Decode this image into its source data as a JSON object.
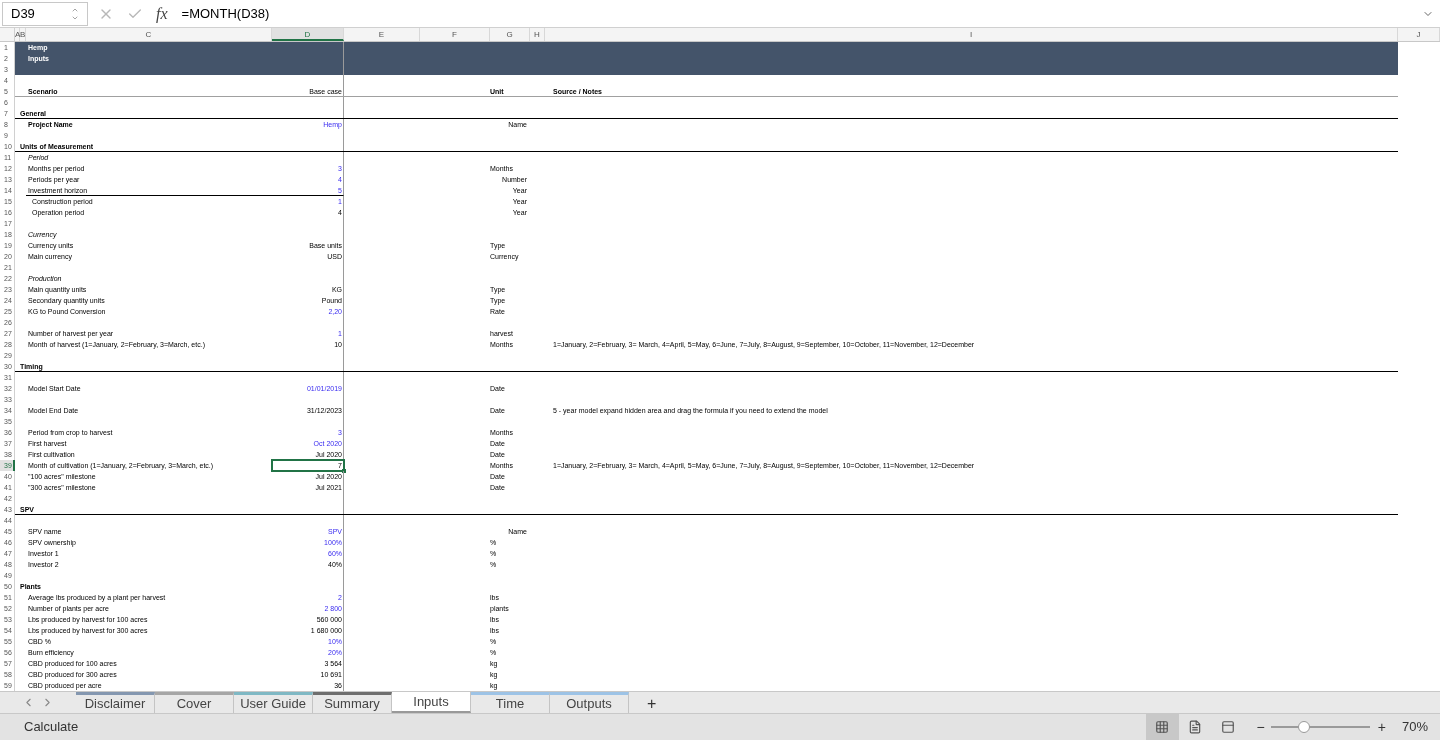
{
  "formula_bar": {
    "name_box": "D39",
    "function_label": "fx",
    "formula": "=MONTH(D38)"
  },
  "columns": [
    {
      "label": "A",
      "selected": false
    },
    {
      "label": "B",
      "selected": false
    },
    {
      "label": "C",
      "selected": false
    },
    {
      "label": "D",
      "selected": true
    },
    {
      "label": "E",
      "selected": false
    },
    {
      "label": "F",
      "selected": false
    },
    {
      "label": "G",
      "selected": false
    },
    {
      "label": "H",
      "selected": false
    },
    {
      "label": "I",
      "selected": false
    },
    {
      "label": "J",
      "selected": false
    }
  ],
  "rows": [
    {
      "n": "1",
      "kind": "banner",
      "label": "Hemp",
      "selected": false
    },
    {
      "n": "2",
      "kind": "banner",
      "label": "Inputs",
      "selected": false
    },
    {
      "n": "3",
      "kind": "banner",
      "selected": false
    },
    {
      "n": "4",
      "kind": "blank",
      "selected": false
    },
    {
      "n": "5",
      "kind": "head",
      "label": "Scenario",
      "value": "Base case",
      "input": false,
      "unit": "Unit",
      "note": "Source / Notes",
      "selected": false
    },
    {
      "n": "6",
      "kind": "blank",
      "selected": false
    },
    {
      "n": "7",
      "kind": "section",
      "label": "General",
      "selected": false
    },
    {
      "n": "8",
      "kind": "field",
      "label": "Project Name",
      "value": "Hemp",
      "input": true,
      "unit": "Name",
      "unit_right": true,
      "selected": false
    },
    {
      "n": "9",
      "kind": "blank",
      "selected": false
    },
    {
      "n": "10",
      "kind": "section",
      "label": "Units of Measurement",
      "selected": false
    },
    {
      "n": "11",
      "kind": "group",
      "label": "Period",
      "selected": false
    },
    {
      "n": "12",
      "kind": "item",
      "label": "Months per period",
      "value": "3",
      "input": true,
      "unit": "Months",
      "selected": false
    },
    {
      "n": "13",
      "kind": "item",
      "label": "Periods per year",
      "value": "4",
      "input": true,
      "unit": "Number",
      "unit_right": true,
      "selected": false
    },
    {
      "n": "14",
      "kind": "ruled",
      "label": "Investment horizon",
      "value": "5",
      "input": true,
      "unit": "Year",
      "unit_right": true,
      "selected": false
    },
    {
      "n": "15",
      "kind": "subitem",
      "label": "Construction period",
      "value": "1",
      "input": true,
      "unit": "Year",
      "unit_right": true,
      "selected": false
    },
    {
      "n": "16",
      "kind": "subitem",
      "label": "Operation period",
      "value": "4",
      "input": false,
      "unit": "Year",
      "unit_right": true,
      "selected": false
    },
    {
      "n": "17",
      "kind": "blank",
      "selected": false
    },
    {
      "n": "18",
      "kind": "group",
      "label": "Currency",
      "selected": false
    },
    {
      "n": "19",
      "kind": "item",
      "label": "Currency units",
      "value": "Base units",
      "input": false,
      "unit": "Type",
      "selected": false
    },
    {
      "n": "20",
      "kind": "item",
      "label": "Main currency",
      "value": "USD",
      "input": false,
      "unit": "Currency",
      "selected": false
    },
    {
      "n": "21",
      "kind": "blank",
      "selected": false
    },
    {
      "n": "22",
      "kind": "group",
      "label": "Production",
      "selected": false
    },
    {
      "n": "23",
      "kind": "item",
      "label": "Main quantity units",
      "value": "KG",
      "input": false,
      "unit": "Type",
      "selected": false
    },
    {
      "n": "24",
      "kind": "item",
      "label": "Secondary quantity units",
      "value": "Pound",
      "input": false,
      "unit": "Type",
      "selected": false
    },
    {
      "n": "25",
      "kind": "item",
      "label": "KG to Pound Conversion",
      "value": "2,20",
      "input": true,
      "unit": "Rate",
      "selected": false
    },
    {
      "n": "26",
      "kind": "blank",
      "selected": false
    },
    {
      "n": "27",
      "kind": "item",
      "label": "Number of harvest per year",
      "value": "1",
      "input": true,
      "unit": "harvest",
      "selected": false
    },
    {
      "n": "28",
      "kind": "item",
      "label": "Month of harvest (1=January, 2=February, 3=March, etc.)",
      "value": "10",
      "input": false,
      "unit": "Months",
      "note": "1=January, 2=February, 3= March, 4=April, 5=May, 6=June, 7=July, 8=August, 9=September, 10=October, 11=November, 12=December",
      "selected": false
    },
    {
      "n": "29",
      "kind": "blank",
      "selected": false
    },
    {
      "n": "30",
      "kind": "section",
      "label": "Timing",
      "selected": false
    },
    {
      "n": "31",
      "kind": "blank",
      "selected": false
    },
    {
      "n": "32",
      "kind": "item",
      "label": "Model Start Date",
      "value": "01/01/2019",
      "input": true,
      "unit": "Date",
      "selected": false
    },
    {
      "n": "33",
      "kind": "blank",
      "selected": false
    },
    {
      "n": "34",
      "kind": "item",
      "label": "Model End Date",
      "value": "31/12/2023",
      "input": false,
      "unit": "Date",
      "note": "5 - year model expand hidden area and drag the formula if you need to extend the model",
      "selected": false
    },
    {
      "n": "35",
      "kind": "blank",
      "selected": false
    },
    {
      "n": "36",
      "kind": "item",
      "label": "Period from crop to harvest",
      "value": "3",
      "input": true,
      "unit": "Months",
      "selected": false
    },
    {
      "n": "37",
      "kind": "item",
      "label": "First harvest",
      "value": "Oct 2020",
      "input": true,
      "unit": "Date",
      "selected": false
    },
    {
      "n": "38",
      "kind": "item",
      "label": "First cultivation",
      "value": "Jul 2020",
      "input": false,
      "unit": "Date",
      "selected": false
    },
    {
      "n": "39",
      "kind": "item",
      "label": "Month of cultivation (1=January, 2=February, 3=March, etc.)",
      "value": "7",
      "input": false,
      "unit": "Months",
      "note": "1=January, 2=February, 3= March, 4=April, 5=May, 6=June, 7=July, 8=August, 9=September, 10=October, 11=November, 12=December",
      "selected": true
    },
    {
      "n": "40",
      "kind": "item",
      "label": "\"100 acres\" milestone",
      "value": "Jul 2020",
      "input": false,
      "unit": "Date",
      "selected": false
    },
    {
      "n": "41",
      "kind": "item",
      "label": "\"300 acres\" milestone",
      "value": "Jul 2021",
      "input": false,
      "unit": "Date",
      "selected": false
    },
    {
      "n": "42",
      "kind": "blank",
      "selected": false
    },
    {
      "n": "43",
      "kind": "section",
      "label": "SPV",
      "selected": false
    },
    {
      "n": "44",
      "kind": "blank",
      "selected": false
    },
    {
      "n": "45",
      "kind": "item",
      "label": "SPV name",
      "value": "SPV",
      "input": true,
      "unit": "Name",
      "unit_right": true,
      "selected": false
    },
    {
      "n": "46",
      "kind": "item",
      "label": "SPV ownership",
      "value": "100%",
      "input": true,
      "unit": "%",
      "selected": false
    },
    {
      "n": "47",
      "kind": "item",
      "label": "Investor 1",
      "value": "60%",
      "input": true,
      "unit": "%",
      "selected": false
    },
    {
      "n": "48",
      "kind": "item",
      "label": "Investor 2",
      "value": "40%",
      "input": false,
      "unit": "%",
      "selected": false
    },
    {
      "n": "49",
      "kind": "blank",
      "selected": false
    },
    {
      "n": "50",
      "kind": "subhead",
      "label": "Plants",
      "selected": false
    },
    {
      "n": "51",
      "kind": "item",
      "label": "Average lbs produced by a plant per harvest",
      "value": "2",
      "input": true,
      "unit": "lbs",
      "selected": false
    },
    {
      "n": "52",
      "kind": "item",
      "label": "Number of plants per acre",
      "value": "2 800",
      "input": true,
      "unit": "plants",
      "selected": false
    },
    {
      "n": "53",
      "kind": "item",
      "label": "Lbs produced by harvest for 100 acres",
      "value": "560 000",
      "input": false,
      "unit": "lbs",
      "selected": false
    },
    {
      "n": "54",
      "kind": "item",
      "label": "Lbs produced by harvest for 300 acres",
      "value": "1 680 000",
      "input": false,
      "unit": "lbs",
      "selected": false
    },
    {
      "n": "55",
      "kind": "item",
      "label": "CBD %",
      "value": "10%",
      "input": true,
      "unit": "%",
      "selected": false
    },
    {
      "n": "56",
      "kind": "item",
      "label": "Burn efficiency",
      "value": "20%",
      "input": true,
      "unit": "%",
      "selected": false
    },
    {
      "n": "57",
      "kind": "item",
      "label": "CBD produced for 100 acres",
      "value": "3 564",
      "input": false,
      "unit": "kg",
      "selected": false
    },
    {
      "n": "58",
      "kind": "item",
      "label": "CBD produced for 300 acres",
      "value": "10 691",
      "input": false,
      "unit": "kg",
      "selected": false
    },
    {
      "n": "59",
      "kind": "item",
      "label": "CBD produced per acre",
      "value": "36",
      "input": false,
      "unit": "kg",
      "selected": false
    }
  ],
  "sheet_tabs": [
    {
      "label": "Disclaimer",
      "selected": false,
      "color": "#8497b0"
    },
    {
      "label": "Cover",
      "selected": false,
      "color": "#a6a6a6"
    },
    {
      "label": "User Guide",
      "selected": false,
      "color": "#7fb8c4"
    },
    {
      "label": "Summary",
      "selected": false,
      "color": "#6e6e6e"
    },
    {
      "label": "Inputs",
      "selected": true
    },
    {
      "label": "Time",
      "selected": false,
      "color": "#9dc3e6"
    },
    {
      "label": "Outputs",
      "selected": false,
      "color": "#9dc3e6"
    }
  ],
  "add_sheet": "+",
  "status_bar": {
    "mode": "Calculate",
    "views": [
      {
        "kind": "normal",
        "selected": true
      },
      {
        "kind": "page-layout",
        "selected": false
      },
      {
        "kind": "page-break",
        "selected": false
      }
    ],
    "zoom_out": "−",
    "zoom_in": "+",
    "zoom": {
      "level": 0.34
    },
    "zoom_reading": "70%"
  }
}
